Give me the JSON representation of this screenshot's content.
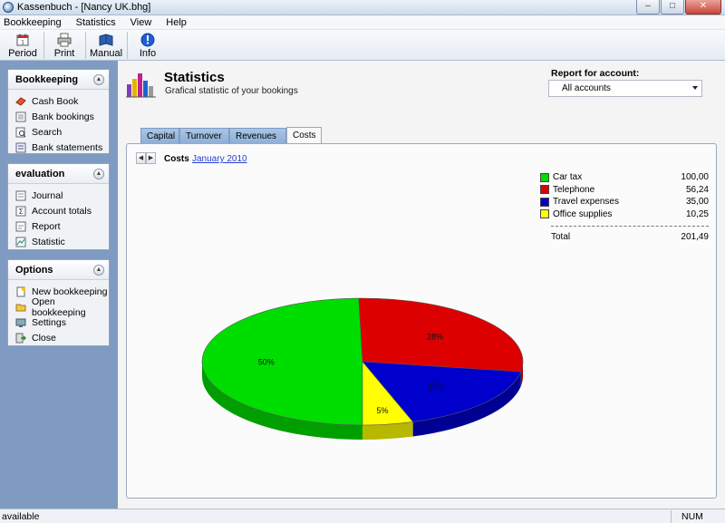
{
  "window": {
    "title": "Kassenbuch - [Nancy UK.bhg]",
    "minimize": "–",
    "maximize": "□",
    "close": "✕"
  },
  "menu": [
    {
      "label": "Bookkeeping"
    },
    {
      "label": "Statistics"
    },
    {
      "label": "View"
    },
    {
      "label": "Help"
    }
  ],
  "toolbar": [
    {
      "label": "Period",
      "icon": "calendar-icon"
    },
    {
      "label": "Print",
      "icon": "printer-icon"
    },
    {
      "label": "Manual",
      "icon": "book-icon"
    },
    {
      "label": "Info",
      "icon": "info-icon"
    }
  ],
  "sidebar": {
    "bookkeeping": {
      "title": "Bookkeeping",
      "items": [
        {
          "label": "Cash Book",
          "icon": "cashbook-icon"
        },
        {
          "label": "Bank bookings",
          "icon": "bank-icon"
        },
        {
          "label": "Search",
          "icon": "search-icon"
        },
        {
          "label": "Bank statements",
          "icon": "statement-icon"
        }
      ]
    },
    "evaluation": {
      "title": "evaluation",
      "items": [
        {
          "label": "Journal",
          "icon": "journal-icon"
        },
        {
          "label": "Account totals",
          "icon": "totals-icon"
        },
        {
          "label": "Report",
          "icon": "report-icon"
        },
        {
          "label": "Statistic",
          "icon": "statistic-icon"
        }
      ]
    },
    "options": {
      "title": "Options",
      "items": [
        {
          "label": "New bookkeeping",
          "icon": "new-icon"
        },
        {
          "label": "Open bookkeeping",
          "icon": "folder-icon"
        },
        {
          "label": "Settings",
          "icon": "settings-icon"
        },
        {
          "label": "Close",
          "icon": "exit-icon"
        }
      ]
    }
  },
  "header": {
    "title": "Statistics",
    "subtitle": "Grafical statistic of your bookings",
    "report_label": "Report for account:",
    "report_value": "All accounts"
  },
  "tabs": [
    {
      "label": "Capital",
      "active": false
    },
    {
      "label": "Turnover",
      "active": false
    },
    {
      "label": "Revenues",
      "active": false
    },
    {
      "label": "Costs",
      "active": true
    }
  ],
  "chart_header": {
    "label": "Costs",
    "period": "January 2010"
  },
  "chart_data": {
    "type": "pie",
    "categories": [
      "Car tax",
      "Telephone",
      "Travel expenses",
      "Office supplies"
    ],
    "values": [
      100.0,
      56.24,
      35.0,
      10.25
    ],
    "display_values": [
      "100,00",
      "56,24",
      "35,00",
      "10,25"
    ],
    "colors": [
      "#00dd00",
      "#dd0000",
      "#0000cc",
      "#ffff00"
    ],
    "slice_labels": [
      "50%",
      "28%",
      "17%",
      "5%"
    ],
    "total_label": "Total",
    "total_value": "201,49"
  },
  "status": {
    "left": "available",
    "right": "NUM"
  }
}
